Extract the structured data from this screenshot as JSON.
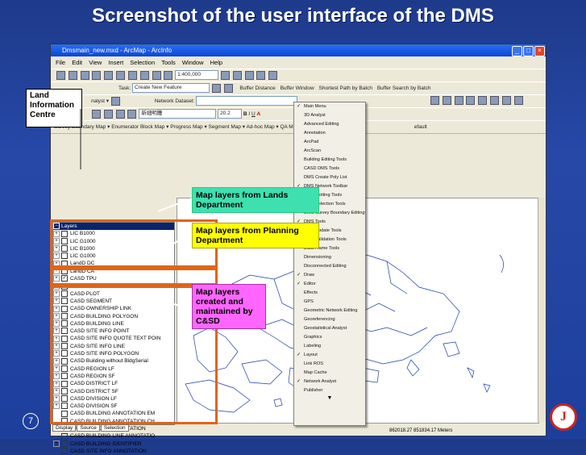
{
  "slide": {
    "title": "Screenshot of the user interface of the DMS",
    "page_number": "7",
    "logo_letter": "J"
  },
  "window": {
    "title": "Dmsmain_new.mxd - ArcMap - ArcInfo",
    "menu": [
      "File",
      "Edit",
      "View",
      "Insert",
      "Selection",
      "Tools",
      "Window",
      "Help"
    ],
    "scale": "1:400,000",
    "task_label": "Task:",
    "task_value": "Create New Feature",
    "toolbar_buttons": [
      "Buffer Distance",
      "Buffer Window",
      "Shortest Path by Batch",
      "Buffer Search by Batch"
    ],
    "network_label": "Network Dataset:",
    "font_value": "新細明體",
    "font_size": "20.2",
    "bold": "B",
    "italic": "I",
    "underline": "U",
    "fontcolor": "A",
    "map_toolbar": [
      "Survey Boundary Map",
      "Enumerator Block Map",
      "Progress Map",
      "Segment Map",
      "Ad-hoc Map",
      "QA Map"
    ],
    "default_label": "efault",
    "status_coords": "862018.27  851834.17 Meters"
  },
  "toc": {
    "tabs": [
      "Display",
      "Source",
      "Selection"
    ],
    "root": "Layers",
    "rows": [
      {
        "pm": "+",
        "checked": false,
        "label": "LIC B1000"
      },
      {
        "pm": "+",
        "checked": false,
        "label": "LIC G1000"
      },
      {
        "pm": "+",
        "checked": false,
        "label": "LIC B1000"
      },
      {
        "pm": "+",
        "checked": false,
        "label": "LIC G1000"
      },
      {
        "pm": "+",
        "checked": false,
        "label": "LandD DC"
      },
      {
        "pm": "+",
        "checked": false,
        "label": "LandD CA"
      },
      {
        "pm": "+",
        "checked": true,
        "label": "CASD TPU"
      },
      {
        "pm": "+",
        "checked": false,
        "label": "CASD SBVC"
      },
      {
        "pm": "+",
        "checked": false,
        "label": "CASD PLOT"
      },
      {
        "pm": "+",
        "checked": false,
        "label": "CASD SEGMENT"
      },
      {
        "pm": "+",
        "checked": false,
        "label": "CASD OWNERSHIP LINK"
      },
      {
        "pm": "+",
        "checked": false,
        "label": "CASD BUILDING POLYGON"
      },
      {
        "pm": "+",
        "checked": false,
        "label": "CASD BUILDING LINE"
      },
      {
        "pm": "+",
        "checked": false,
        "label": "CASD SITE INFO POINT"
      },
      {
        "pm": "+",
        "checked": false,
        "label": "CASD SITE INFO QUOTE TEXT POIN"
      },
      {
        "pm": "+",
        "checked": false,
        "label": "CASD SITE INFO LINE"
      },
      {
        "pm": "+",
        "checked": false,
        "label": "CASD SITE INFO POLYGON"
      },
      {
        "pm": "+",
        "checked": false,
        "label": "CASD Building without BldgSerial"
      },
      {
        "pm": "+",
        "checked": false,
        "label": "CASD REGION LF"
      },
      {
        "pm": "+",
        "checked": false,
        "label": "CASD REGION SF"
      },
      {
        "pm": "+",
        "checked": false,
        "label": "CASD DISTRICT LF"
      },
      {
        "pm": "+",
        "checked": false,
        "label": "CASD DISTRICT SF"
      },
      {
        "pm": "+",
        "checked": false,
        "label": "CASD DIVISION LF"
      },
      {
        "pm": "+",
        "checked": false,
        "label": "CASD DIVISION SF"
      },
      {
        "pm": "",
        "checked": false,
        "label": "CASD BUILDING ANNOTATION EM"
      },
      {
        "pm": "",
        "checked": false,
        "label": "CASD BUILDING ANNOTATION CH"
      },
      {
        "pm": "",
        "checked": false,
        "label": "CASD BUILDING ANNOTATION"
      },
      {
        "pm": "",
        "checked": false,
        "label": "CASD BUILDING LINE ANNOTATIO"
      },
      {
        "pm": "+",
        "checked": false,
        "label": "CASD BUILDING IDENTIFIER"
      },
      {
        "pm": "",
        "checked": false,
        "label": "CASD SITE INFO ANNOTATION"
      }
    ]
  },
  "context_menu": [
    {
      "label": "Main Menu",
      "checked": true
    },
    {
      "label": "3D Analyst",
      "checked": false
    },
    {
      "label": "Advanced Editing",
      "checked": false
    },
    {
      "label": "Annotation",
      "checked": false
    },
    {
      "label": "ArcPad",
      "checked": false
    },
    {
      "label": "ArcScan",
      "checked": false
    },
    {
      "label": "Building Editing Tools",
      "checked": false
    },
    {
      "label": "CASD DMS Tools",
      "checked": false
    },
    {
      "label": "DMS Create Poly List",
      "checked": false
    },
    {
      "label": "DMS Network Toolbar",
      "checked": true
    },
    {
      "label": "DMS Plotting Tools",
      "checked": true
    },
    {
      "label": "DMS Selection Tools",
      "checked": false
    },
    {
      "label": "DMS Survey Boundary Editing Tools",
      "checked": false
    },
    {
      "label": "DMS Tools",
      "checked": true
    },
    {
      "label": "DMS Update Tools",
      "checked": true
    },
    {
      "label": "DMS Validation Tools",
      "checked": true
    },
    {
      "label": "Data Frame Tools",
      "checked": false
    },
    {
      "label": "Dimensioning",
      "checked": false
    },
    {
      "label": "Disconnected Editing",
      "checked": false
    },
    {
      "label": "Draw",
      "checked": true
    },
    {
      "label": "Editor",
      "checked": true
    },
    {
      "label": "Effects",
      "checked": false
    },
    {
      "label": "GPS",
      "checked": false
    },
    {
      "label": "Geometric Network Editing",
      "checked": false
    },
    {
      "label": "Georeferencing",
      "checked": false
    },
    {
      "label": "Geostatistical Analyst",
      "checked": false
    },
    {
      "label": "Graphics",
      "checked": false
    },
    {
      "label": "Labeling",
      "checked": false
    },
    {
      "label": "Layout",
      "checked": true
    },
    {
      "label": "Link ROS",
      "checked": false
    },
    {
      "label": "Map Cache",
      "checked": false
    },
    {
      "label": "Network Analyst",
      "checked": true
    },
    {
      "label": "Publisher",
      "checked": false
    }
  ],
  "callouts": {
    "lands": "Map layers from Lands Department",
    "planning": "Map layers from Planning Department",
    "csd": "Map layers created and maintained by C&SD",
    "lic": "Land Information Centre"
  },
  "colors": {
    "callout_green": "#3fe0b0",
    "callout_yellow": "#ffff00",
    "callout_pink": "#ff66ff",
    "highlight_orange": "#e0641a",
    "slide_bg": "#2748a8"
  }
}
